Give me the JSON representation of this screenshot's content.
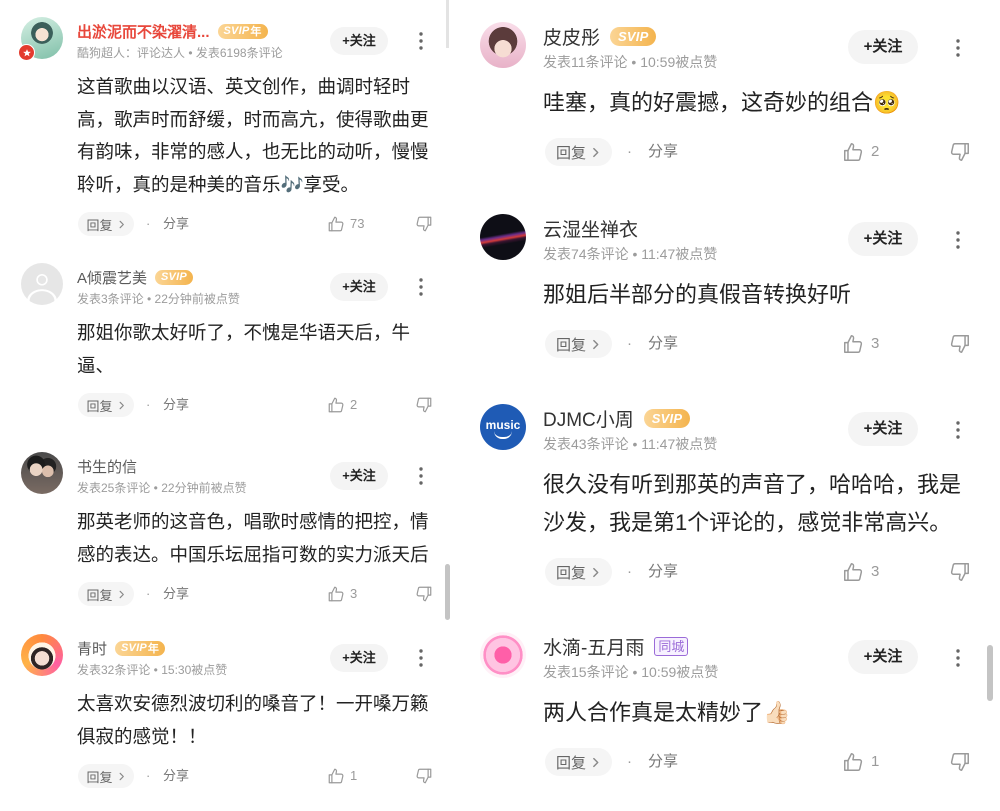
{
  "labels": {
    "follow": "+关注",
    "reply": "回复",
    "share": "分享",
    "separator": "·"
  },
  "colors": {
    "svip_badge": "#f4b44e",
    "local_tag": "#9b6bd8"
  },
  "left": {
    "comments": [
      {
        "user": "出淤泥而不染濯清...",
        "name_color": "#e8473b",
        "svip": "SVIP",
        "svip_year": "年",
        "meta": "酷狗超人：评论达人 • 发表6198条评论",
        "text": "这首歌曲以汉语、英文创作，曲调时轻时高，歌声时而舒缓，时而高亢，使得歌曲更有韵味，非常的感人，也无比的动听，慢慢聆听，真的是种美的音乐🎶享受。",
        "likes": "73"
      },
      {
        "user": "A倾震艺美",
        "svip": "SVIP",
        "meta": "发表3条评论 • 22分钟前被点赞",
        "text": "那姐你歌太好听了，不愧是华语天后，牛逼、",
        "likes": "2"
      },
      {
        "user": "书生的信",
        "meta": "发表25条评论 • 22分钟前被点赞",
        "text": "那英老师的这音色，唱歌时感情的把控，情感的表达。中国乐坛屈指可数的实力派天后",
        "likes": "3"
      },
      {
        "user": "青时",
        "svip": "SVIP",
        "svip_year": "年",
        "meta": "发表32条评论 • 15:30被点赞",
        "text": "太喜欢安德烈波切利的嗓音了！一开嗓万籁俱寂的感觉！！",
        "likes": "1"
      }
    ]
  },
  "right": {
    "comments": [
      {
        "user": "皮皮彤",
        "svip": "SVIP",
        "meta": "发表11条评论 • 10:59被点赞",
        "text": "哇塞，真的好震撼，这奇妙的组合🥺",
        "likes": "2"
      },
      {
        "user": "云湿坐禅衣",
        "meta": "发表74条评论 • 11:47被点赞",
        "text": "那姐后半部分的真假音转换好听",
        "likes": "3"
      },
      {
        "user": "DJMC小周",
        "svip": "SVIP",
        "avatar_text": "music",
        "meta": "发表43条评论 • 11:47被点赞",
        "text": "很久没有听到那英的声音了，哈哈哈，我是沙发，我是第1个评论的，感觉非常高兴。",
        "likes": "3"
      },
      {
        "user": "水滴-五月雨",
        "local_tag": "同城",
        "meta": "发表15条评论 • 10:59被点赞",
        "text": "两人合作真是太精妙了👍🏻",
        "likes": "1"
      }
    ]
  }
}
